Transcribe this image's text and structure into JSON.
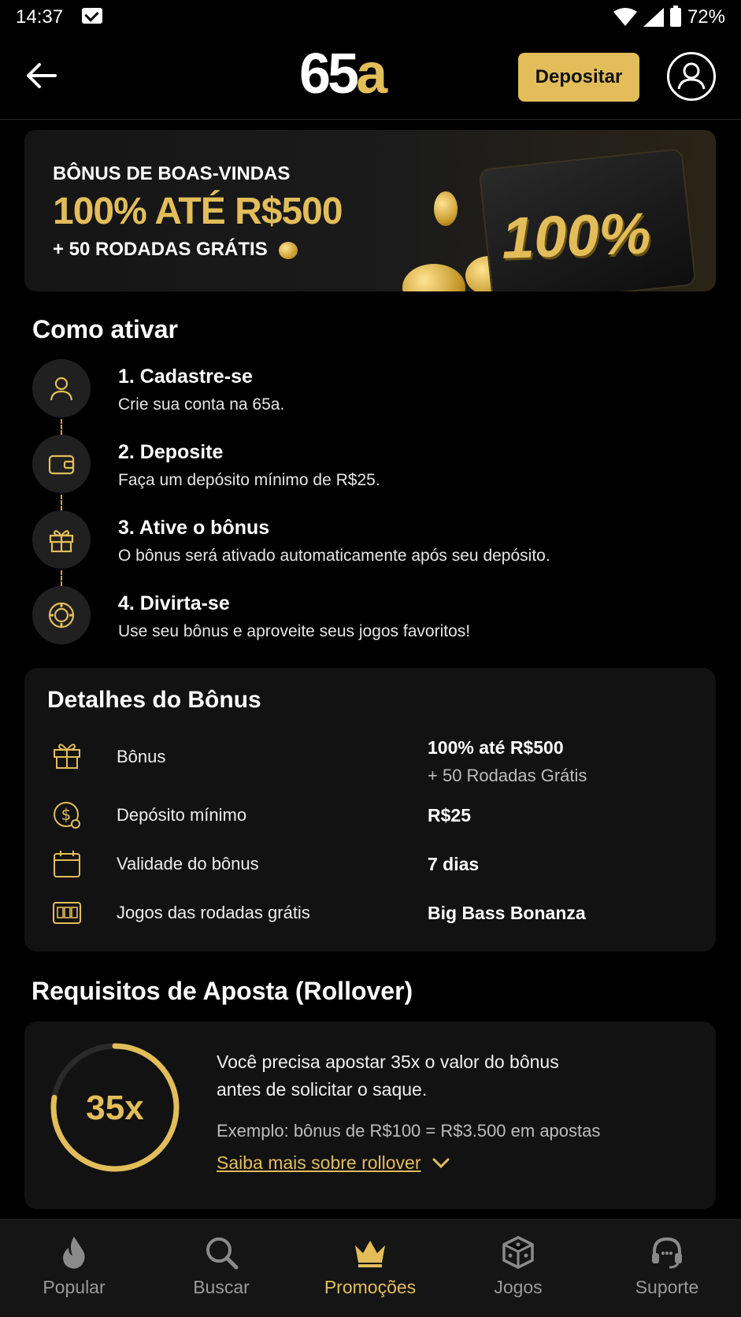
{
  "status_bar": {
    "time": "14:37",
    "battery": "72%"
  },
  "header": {
    "logo_number": "65",
    "logo_letter": "a",
    "deposit_label": "Depositar"
  },
  "banner": {
    "line1": "BÔNUS DE BOAS-VINDAS",
    "line2": "100% ATÉ R$500",
    "line3": "+ 50 RODADAS GRÁTIS",
    "badge": "100%"
  },
  "activate": {
    "title": "Como ativar",
    "steps": [
      {
        "title": "1. Cadastre-se",
        "desc": "Crie sua conta na 65a."
      },
      {
        "title": "2. Deposite",
        "desc": "Faça um depósito mínimo de R$25."
      },
      {
        "title": "3. Ative o bônus",
        "desc": "O bônus será ativado automaticamente após seu depósito."
      },
      {
        "title": "4. Divirta-se",
        "desc": "Use seu bônus e aproveite seus jogos favoritos!"
      }
    ]
  },
  "details": {
    "title": "Detalhes do Bônus",
    "rows": [
      {
        "icon": "gift-icon",
        "label": "Bônus",
        "value": "100% até R$500",
        "sub": "+ 50 Rodadas Grátis"
      },
      {
        "icon": "dollar-coin-icon",
        "label": "Depósito mínimo",
        "value": "R$25"
      },
      {
        "icon": "calendar-icon",
        "label": "Validade do bônus",
        "value": "7 dias"
      },
      {
        "icon": "slot-machine-icon",
        "label": "Jogos das rodadas grátis",
        "value": "Big Bass Bonanza"
      }
    ]
  },
  "rollover": {
    "title": "Requisitos de Aposta (Rollover)",
    "multiplier": "35x",
    "text_line1": "Você precisa apostar 35x o valor do bônus",
    "text_line2": "antes de solicitar o saque.",
    "example": "Exemplo: bônus de R$100 = R$3.500 em apostas",
    "link": "Saiba mais sobre rollover"
  },
  "bottom_nav": {
    "items": [
      {
        "label": "Popular",
        "icon": "flame-icon"
      },
      {
        "label": "Buscar",
        "icon": "search-icon"
      },
      {
        "label": "Promoções",
        "icon": "crown-icon",
        "active": true
      },
      {
        "label": "Jogos",
        "icon": "dice-icon"
      },
      {
        "label": "Suporte",
        "icon": "headset-icon"
      }
    ]
  },
  "colors": {
    "accent": "#e2bd5a",
    "background": "#000000",
    "card": "#121212"
  }
}
